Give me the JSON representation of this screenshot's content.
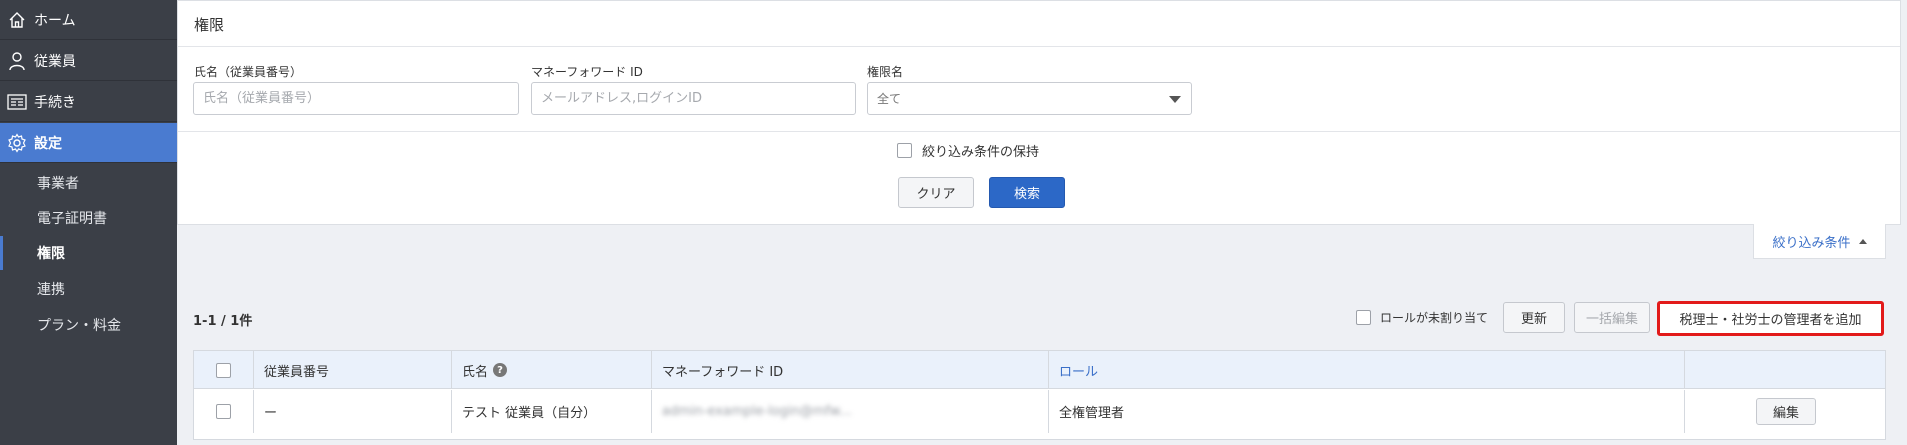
{
  "sidebar": {
    "items": [
      {
        "label": "ホーム",
        "icon": "home-icon"
      },
      {
        "label": "従業員",
        "icon": "person-icon"
      },
      {
        "label": "手続き",
        "icon": "form-icon"
      },
      {
        "label": "設定",
        "icon": "gear-icon",
        "active": true
      }
    ],
    "sub_items": [
      {
        "label": "事業者"
      },
      {
        "label": "電子証明書"
      },
      {
        "label": "権限",
        "current": true
      },
      {
        "label": "連携"
      },
      {
        "label": "プラン・料金"
      }
    ]
  },
  "filter": {
    "title": "権限",
    "name_label": "氏名（従業員番号）",
    "name_placeholder": "氏名（従業員番号）",
    "mfid_label": "マネーフォワード ID",
    "mfid_placeholder": "メールアドレス,ログインID",
    "role_label": "権限名",
    "role_value": "全て",
    "keep_label": "絞り込み条件の保持",
    "clear_label": "クリア",
    "search_label": "検索",
    "collapse_label": "絞り込み条件"
  },
  "list": {
    "count": "1-1 / 1件",
    "unassigned_label": "ロールが未割り当て",
    "refresh_label": "更新",
    "bulk_edit_label": "一括編集",
    "add_admin_label": "税理士・社労士の管理者を追加"
  },
  "table": {
    "headers": [
      "従業員番号",
      "氏名",
      "マネーフォワード ID",
      "ロール"
    ],
    "rows": [
      {
        "employee_no": "ー",
        "name": "テスト 従業員（自分）",
        "mfid": "admin-example-login@mfw...",
        "role": "全権管理者",
        "edit_label": "編集"
      }
    ]
  },
  "colors": {
    "sidebar_bg": "#3b3f47",
    "active_nav": "#4a7bd0",
    "primary_button": "#2c68c7",
    "highlight_border": "#e21a1a",
    "link": "#3a6fc8"
  }
}
